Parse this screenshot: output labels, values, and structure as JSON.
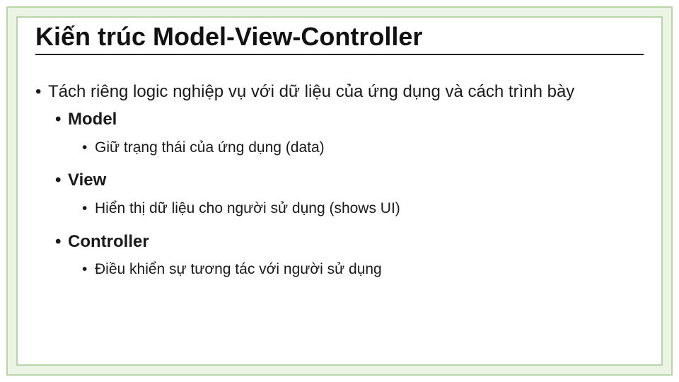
{
  "title": "Kiến trúc Model-View-Controller",
  "bullets": {
    "intro": "Tách riêng logic nghiệp vụ với dữ liệu của ứng dụng và cách trình bày",
    "model": {
      "label": "Model",
      "detail": "Giữ trạng thái của ứng dụng (data)"
    },
    "view": {
      "label": "View",
      "detail": "Hiển thị dữ liệu cho người sử dụng (shows UI)"
    },
    "controller": {
      "label": "Controller",
      "detail": "Điều khiển sự tương tác với người sử dụng"
    }
  }
}
